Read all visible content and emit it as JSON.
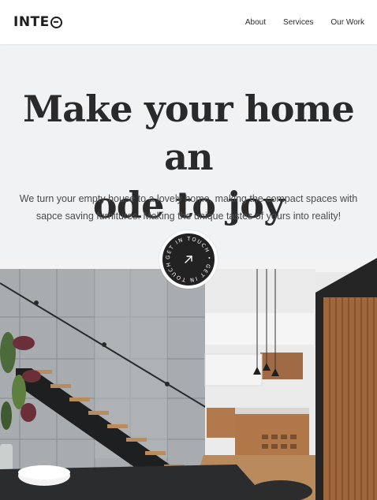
{
  "brand": {
    "logo_text_a": "INTE",
    "logo_text_b": ""
  },
  "nav": {
    "items": [
      "About",
      "Services",
      "Our Work"
    ]
  },
  "hero": {
    "title_line1": "Make your home an",
    "title_line2": "ode to joy",
    "subtitle_line1": "We turn your empty house to a lovely home, making the compact spaces with",
    "subtitle_line2": "sapce saving furnitures. Making the unique tastes of yours into reality!"
  },
  "badge": {
    "ring_text": "GET IN TOUCH • GET IN TOUCH • ",
    "icon": "arrow-up-right-icon"
  },
  "colors": {
    "background": "#f1f2f4",
    "header": "#ffffff",
    "text": "#2a2a2a",
    "badge": "#222222"
  }
}
